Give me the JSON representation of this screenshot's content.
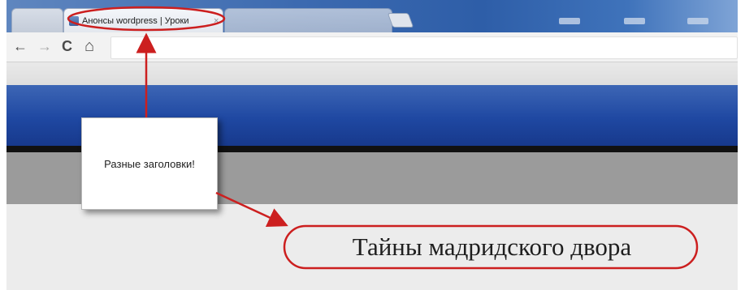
{
  "browser": {
    "tab": {
      "title": "Анонсы wordpress | Уроки",
      "close_glyph": "×"
    },
    "nav": {
      "back": "←",
      "forward": "→",
      "reload": "C",
      "home": "⌂"
    },
    "accent_color": "#2e5ea8"
  },
  "annotation": {
    "text": "Разные заголовки!",
    "color": "#cc1f1f"
  },
  "page": {
    "heading": "Тайны мадридского двора"
  }
}
